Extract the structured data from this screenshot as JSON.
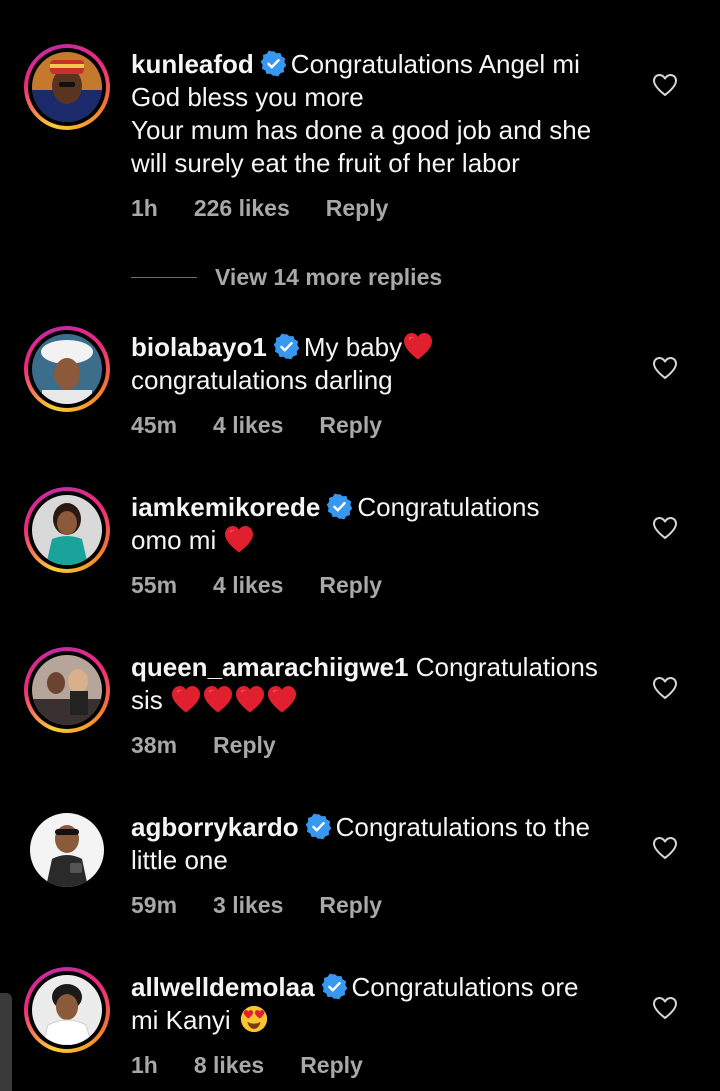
{
  "colors": {
    "background": "#000000",
    "text": "#f5f5f5",
    "secondary": "#a8a8a8",
    "verified": "#3897f0",
    "heart": "#e0202f"
  },
  "view_replies": "View 14 more replies",
  "comments": [
    {
      "username": "kunleafod",
      "verified": true,
      "lines": [
        "Congratulations Angel mi",
        "God bless you more",
        "Your mum has done a good job and she",
        "will surely eat the fruit of her labor"
      ],
      "time": "1h",
      "likes": "226 likes",
      "reply": "Reply"
    },
    {
      "username": "biolabayo1",
      "verified": true,
      "lines": [
        "My baby",
        "congratulations darling"
      ],
      "time": "45m",
      "likes": "4 likes",
      "reply": "Reply"
    },
    {
      "username": "iamkemikorede",
      "verified": true,
      "lines": [
        "Congratulations",
        "omo mi"
      ],
      "time": "55m",
      "likes": "4 likes",
      "reply": "Reply"
    },
    {
      "username": "queen_amarachiigwe1",
      "verified": false,
      "lines": [
        "Congratulations",
        "sis"
      ],
      "time": "38m",
      "likes": "",
      "reply": "Reply"
    },
    {
      "username": "agborrykardo",
      "verified": true,
      "lines": [
        "Congratulations to the",
        "little one"
      ],
      "time": "59m",
      "likes": "3 likes",
      "reply": "Reply"
    },
    {
      "username": "allwelldemolaa",
      "verified": true,
      "lines": [
        "Congratulations ore",
        "mi Kanyi"
      ],
      "time": "1h",
      "likes": "8 likes",
      "reply": "Reply"
    }
  ],
  "icons": {
    "verified": "verified-badge-icon",
    "like": "heart-outline-icon",
    "red_heart": "red-heart-emoji",
    "heart_eyes": "heart-eyes-emoji"
  }
}
